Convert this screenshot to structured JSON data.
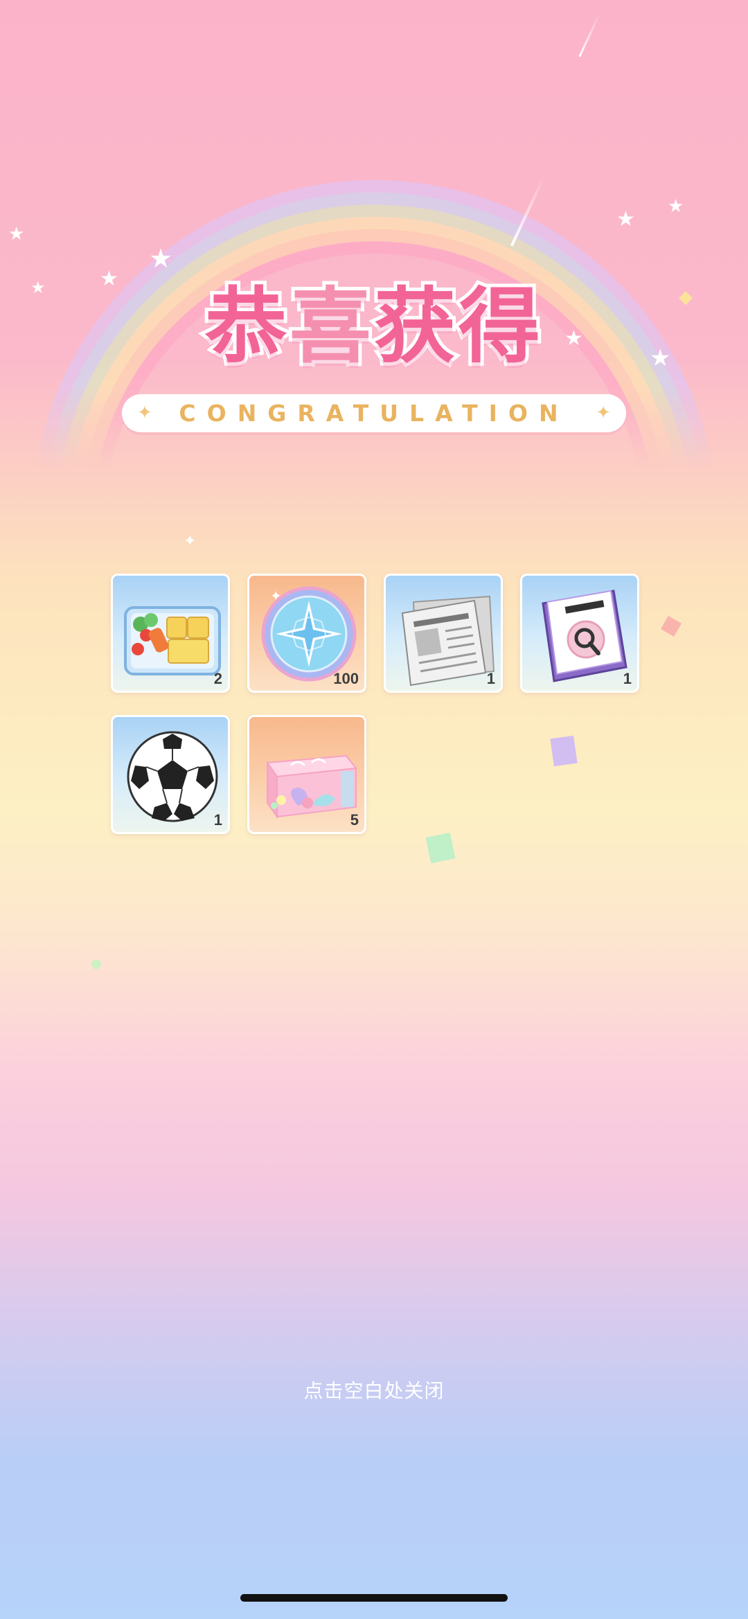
{
  "header": {
    "title_chars": [
      "恭",
      "喜",
      "获",
      "得"
    ],
    "subtitle": "CONGRATULATION"
  },
  "rewards": [
    {
      "name": "bento-box",
      "icon": "bento-box-icon",
      "quantity": "2"
    },
    {
      "name": "star-coin",
      "icon": "star-coin-icon",
      "quantity": "100"
    },
    {
      "name": "newspaper",
      "icon": "newspaper-icon",
      "quantity": "1"
    },
    {
      "name": "detective-book",
      "icon": "detective-book-icon",
      "quantity": "1"
    },
    {
      "name": "soccer-ball",
      "icon": "soccer-ball-icon",
      "quantity": "1"
    },
    {
      "name": "gift-box",
      "icon": "gift-box-icon",
      "quantity": "5"
    }
  ],
  "footer": {
    "close_hint": "点击空白处关闭"
  },
  "colors": {
    "title_pink": "#f26496",
    "subtitle_gold": "#e9b35f",
    "card_border": "#ffffff"
  }
}
